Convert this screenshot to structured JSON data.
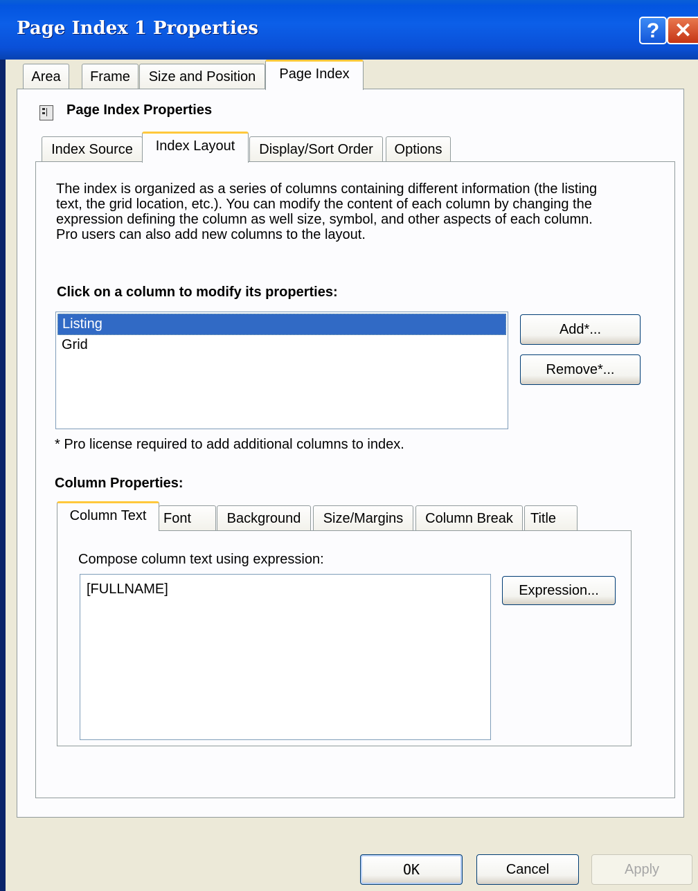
{
  "window": {
    "title": "Page Index 1 Properties",
    "help_button": "?",
    "close_button": "✕"
  },
  "top_tabs": [
    {
      "label": "Area",
      "active": false
    },
    {
      "label": "Frame",
      "active": false
    },
    {
      "label": "Size and Position",
      "active": false
    },
    {
      "label": "Page Index",
      "active": true
    }
  ],
  "section_title": "Page Index Properties",
  "inner_tabs": [
    {
      "label": "Index Source",
      "active": false
    },
    {
      "label": "Index Layout",
      "active": true
    },
    {
      "label": "Display/Sort Order",
      "active": false
    },
    {
      "label": "Options",
      "active": false
    }
  ],
  "description": [
    "The index is organized as a series of columns containing different information (the listing",
    "text, the grid location, etc.).  You can modify the content of each column by changing the",
    "expression defining the column as well size, symbol, and other aspects of each column.",
    "Pro users can also add new columns to the layout."
  ],
  "columns_heading": "Click on a column to modify its properties:",
  "columns_list": [
    {
      "label": "Listing",
      "selected": true
    },
    {
      "label": "Grid",
      "selected": false
    }
  ],
  "add_button": "Add*...",
  "remove_button": "Remove*...",
  "pro_note": "* Pro license required to add additional columns to index.",
  "column_properties_heading": "Column Properties:",
  "column_tabs": [
    {
      "label": "Column Text",
      "active": true
    },
    {
      "label": "Font",
      "active": false
    },
    {
      "label": "Background",
      "active": false
    },
    {
      "label": "Size/Margins",
      "active": false
    },
    {
      "label": "Column Break",
      "active": false
    },
    {
      "label": "Title",
      "active": false
    }
  ],
  "compose_label": "Compose column text using expression:",
  "expression_value": "[FULLNAME]",
  "expression_button": "Expression...",
  "footer": {
    "ok": "OK",
    "cancel": "Cancel",
    "apply": "Apply"
  }
}
